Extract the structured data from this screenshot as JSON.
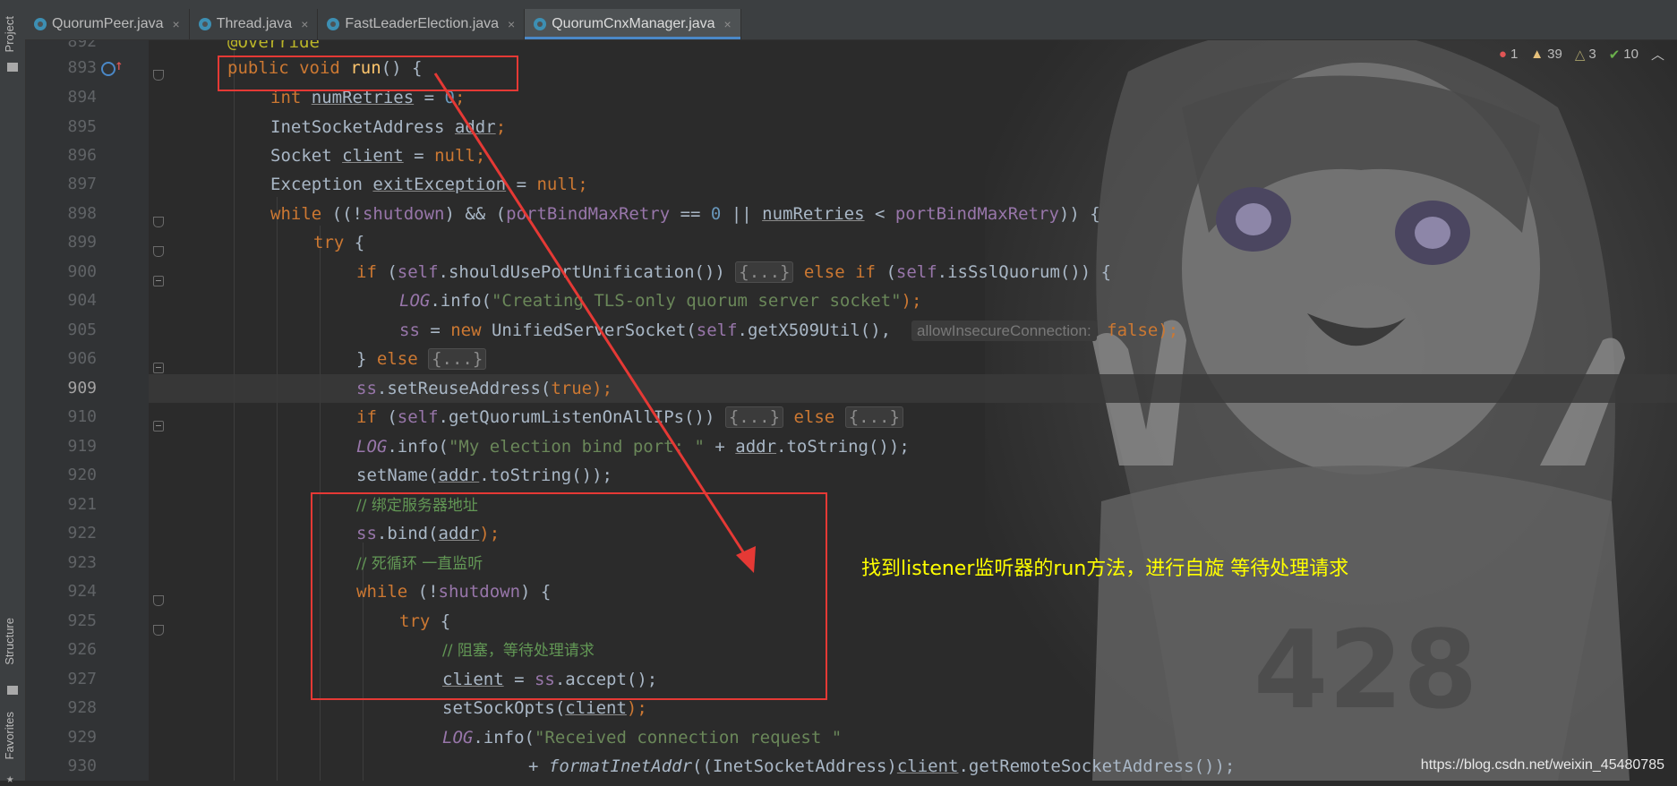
{
  "tabs": [
    {
      "label": "QuorumPeer.java",
      "active": false
    },
    {
      "label": "Thread.java",
      "active": false
    },
    {
      "label": "FastLeaderElection.java",
      "active": false
    },
    {
      "label": "QuorumCnxManager.java",
      "active": true
    }
  ],
  "tool_window_labels": {
    "project": "Project",
    "structure": "Structure",
    "favorites": "Favorites"
  },
  "inspections": {
    "errors": "1",
    "warnings": "39",
    "weak_warnings": "3",
    "typos": "10"
  },
  "line_numbers": [
    "892",
    "893",
    "894",
    "895",
    "896",
    "897",
    "898",
    "899",
    "900",
    "904",
    "905",
    "906",
    "909",
    "910",
    "919",
    "920",
    "921",
    "922",
    "923",
    "924",
    "925",
    "926",
    "927",
    "928",
    "929",
    "930"
  ],
  "code": {
    "l892": {
      "annotation": "@Override"
    },
    "l893": {
      "mod": "public",
      "type": "void",
      "name": "run",
      "rest": "() {"
    },
    "l894": {
      "type": "int",
      "var": "numRetries",
      "eq": " = ",
      "val": "0",
      "end": ";"
    },
    "l895": {
      "type": "InetSocketAddress",
      "var": "addr",
      "end": ";"
    },
    "l896": {
      "type": "Socket",
      "var": "client",
      "eq": " = ",
      "val": "null",
      "end": ";"
    },
    "l897": {
      "type": "Exception",
      "var": "exitException",
      "eq": " = ",
      "val": "null",
      "end": ";"
    },
    "l898": {
      "kw": "while",
      "p1": " ((!",
      "f1": "shutdown",
      "p2": ") && (",
      "f2": "portBindMaxRetry",
      "p3": " == ",
      "n": "0",
      "p4": " || ",
      "v": "numRetries",
      "p5": " < ",
      "f3": "portBindMaxRetry",
      "p6": ")) {"
    },
    "l899": {
      "kw": "try",
      "rest": " {"
    },
    "l900": {
      "kw": "if",
      "p1": " (",
      "self": "self",
      "call": ".shouldUsePortUnification()) ",
      "fold": "{...}",
      "kw2": " else if",
      "p2": " (",
      "self2": "self",
      "call2": ".isSslQuorum()) {"
    },
    "l904": {
      "log": "LOG",
      "call": ".info(",
      "str": "\"Creating TLS-only quorum server socket\"",
      "end": ");"
    },
    "l905": {
      "fld": "ss",
      "eq": " = ",
      "kw": "new",
      "call": " UnifiedServerSocket(",
      "self": "self",
      "call2": ".getX509Util(), ",
      "hint": "allowInsecureConnection:",
      "val": " false",
      "end": ");"
    },
    "l906": {
      "p": "} ",
      "kw": "else",
      "fold": "{...}"
    },
    "l909": {
      "fld": "ss",
      "call": ".setReuseAddress(",
      "val": "true",
      "end": ");"
    },
    "l910": {
      "kw": "if",
      "p1": " (",
      "self": "self",
      "call": ".getQuorumListenOnAllIPs()) ",
      "fold": "{...}",
      "kw2": " else ",
      "fold2": "{...}"
    },
    "l919": {
      "log": "LOG",
      "call": ".info(",
      "str": "\"My election bind port: \"",
      "p": " + ",
      "var": "addr",
      "call2": ".toString());"
    },
    "l920": {
      "call": "setName(",
      "var": "addr",
      "call2": ".toString());"
    },
    "l921": {
      "comment": "// 绑定服务器地址"
    },
    "l922": {
      "fld": "ss",
      "call": ".bind(",
      "var": "addr",
      "end": ");"
    },
    "l923": {
      "comment": "// 死循环 一直监听"
    },
    "l924": {
      "kw": "while",
      "p1": " (!",
      "f": "shutdown",
      "p2": ") {"
    },
    "l925": {
      "kw": "try",
      "rest": " {"
    },
    "l926": {
      "comment": "// 阻塞，等待处理请求"
    },
    "l927": {
      "var": "client",
      "eq": " = ",
      "fld": "ss",
      "call": ".accept();"
    },
    "l928": {
      "call": "setSockOpts(",
      "var": "client",
      "end": ");"
    },
    "l929": {
      "log": "LOG",
      "call": ".info(",
      "str": "\"Received connection request \""
    },
    "l930": {
      "p": "+ ",
      "fn": "formatInetAddr",
      "call": "((InetSocketAddress)",
      "var": "client",
      "call2": ".getRemoteSocketAddress());"
    }
  },
  "annotation_text": "找到listener监听器的run方法，进行自旋 等待处理请求",
  "watermark": "https://blog.csdn.net/weixin_45480785",
  "colors": {
    "highlight_box": "#e53935",
    "annotation_text": "#ffff00",
    "tab_accent": "#4a88c7"
  }
}
